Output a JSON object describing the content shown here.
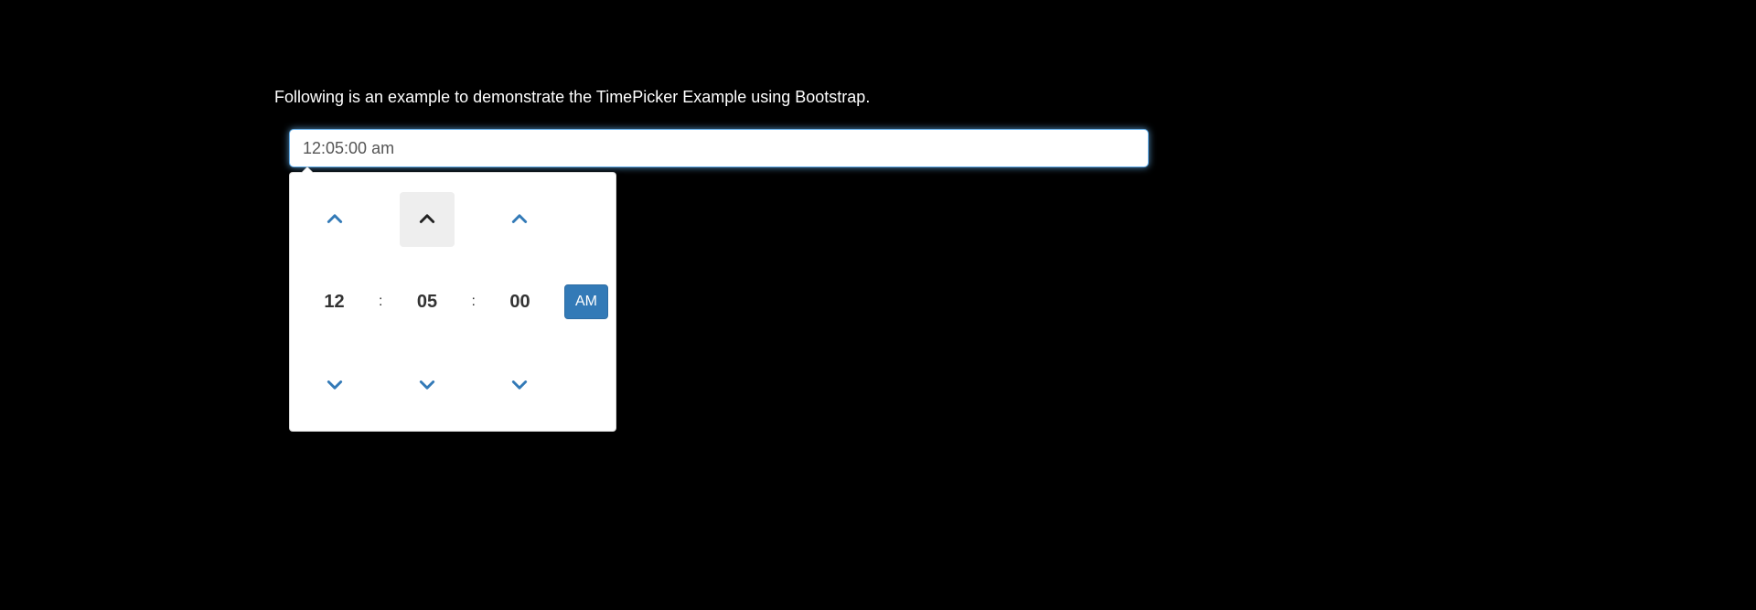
{
  "description": "Following is an example to demonstrate the TimePicker Example using Bootstrap.",
  "input": {
    "value": "12:05:00 am"
  },
  "picker": {
    "hour": "12",
    "minute": "05",
    "second": "00",
    "meridian": "AM",
    "separator": ":"
  }
}
